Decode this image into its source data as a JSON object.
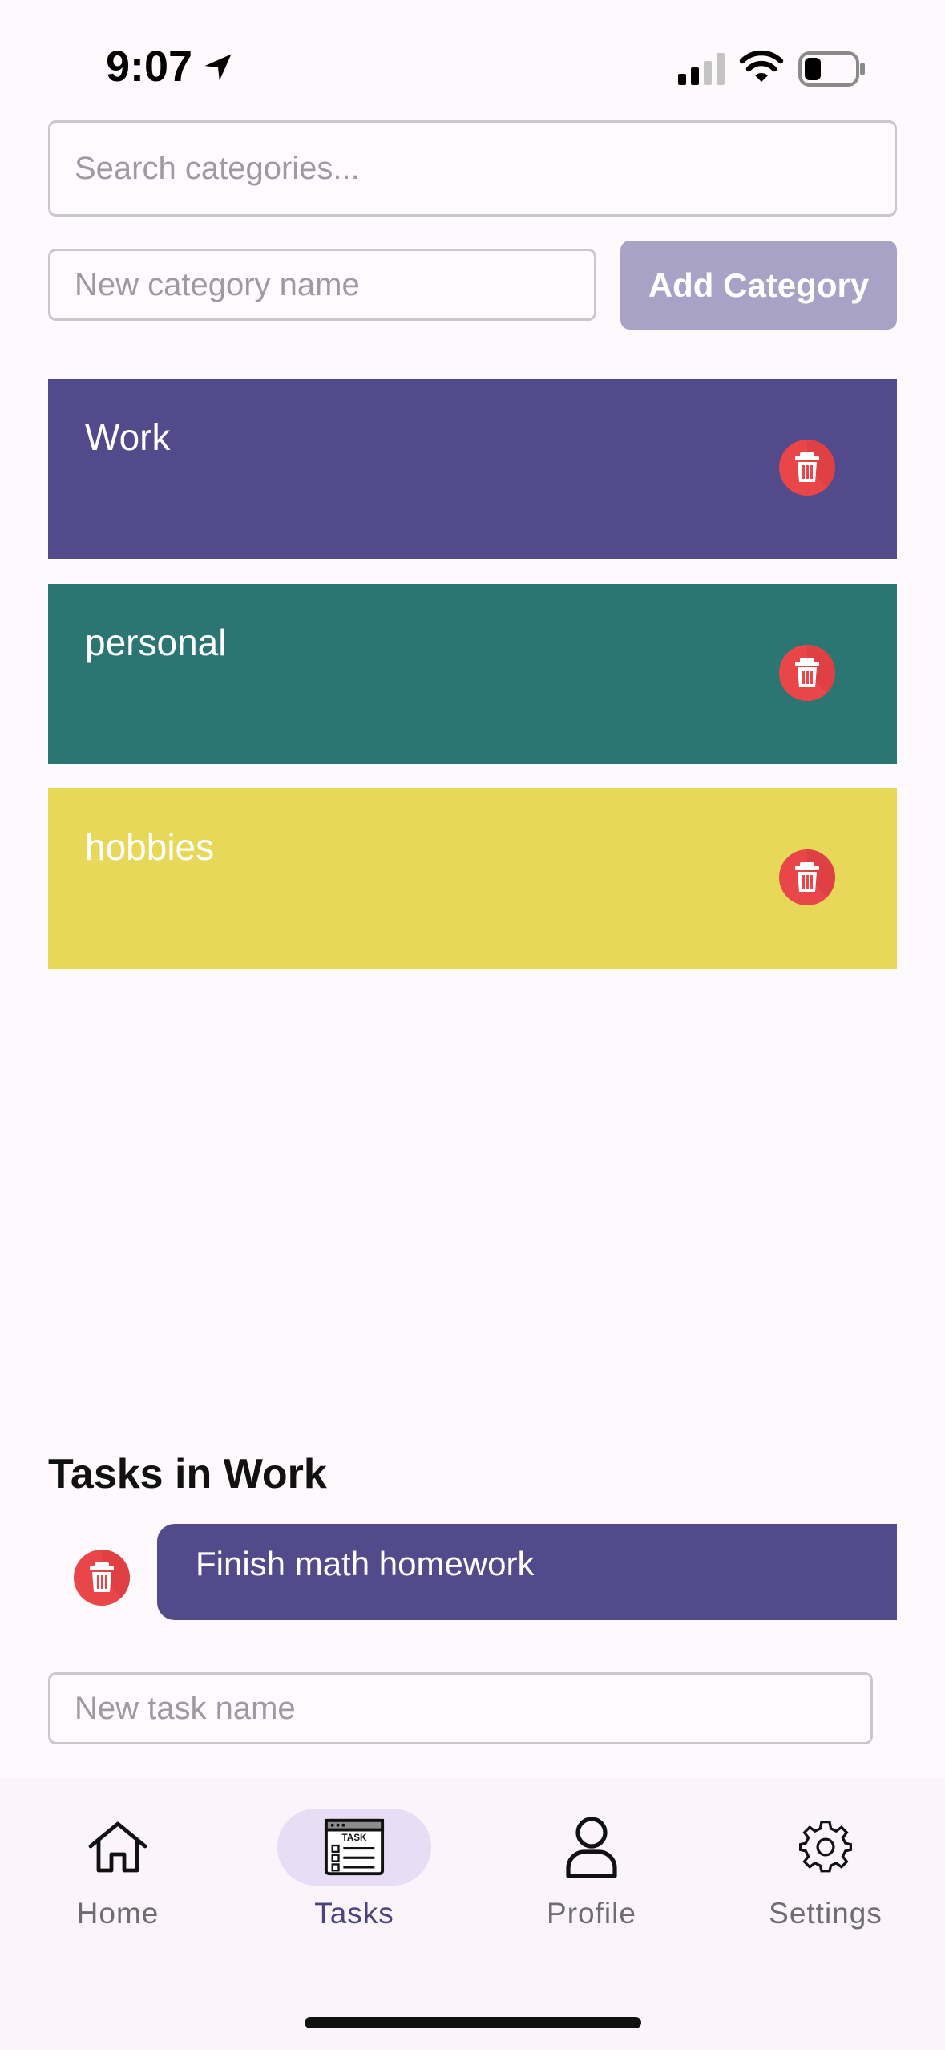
{
  "status_bar": {
    "time": "9:07"
  },
  "search": {
    "placeholder": "Search categories..."
  },
  "new_category": {
    "placeholder": "New category name",
    "button_label": "Add Category"
  },
  "categories": [
    {
      "name": "Work",
      "color": "#524a8a"
    },
    {
      "name": "personal",
      "color": "#2b7572"
    },
    {
      "name": "hobbies",
      "color": "#e8d85a"
    }
  ],
  "tasks_section": {
    "heading": "Tasks in Work",
    "tasks": [
      {
        "name": "Finish math homework"
      }
    ],
    "new_task_placeholder": "New task name"
  },
  "bottom_nav": {
    "items": [
      {
        "label": "Home",
        "icon": "home-icon",
        "active": false
      },
      {
        "label": "Tasks",
        "icon": "task-list-icon",
        "active": true
      },
      {
        "label": "Profile",
        "icon": "person-icon",
        "active": false
      },
      {
        "label": "Settings",
        "icon": "gear-icon",
        "active": false
      }
    ]
  },
  "colors": {
    "accent": "#524a8a",
    "delete": "#e9464a",
    "add_button": "#a8a3c6"
  }
}
